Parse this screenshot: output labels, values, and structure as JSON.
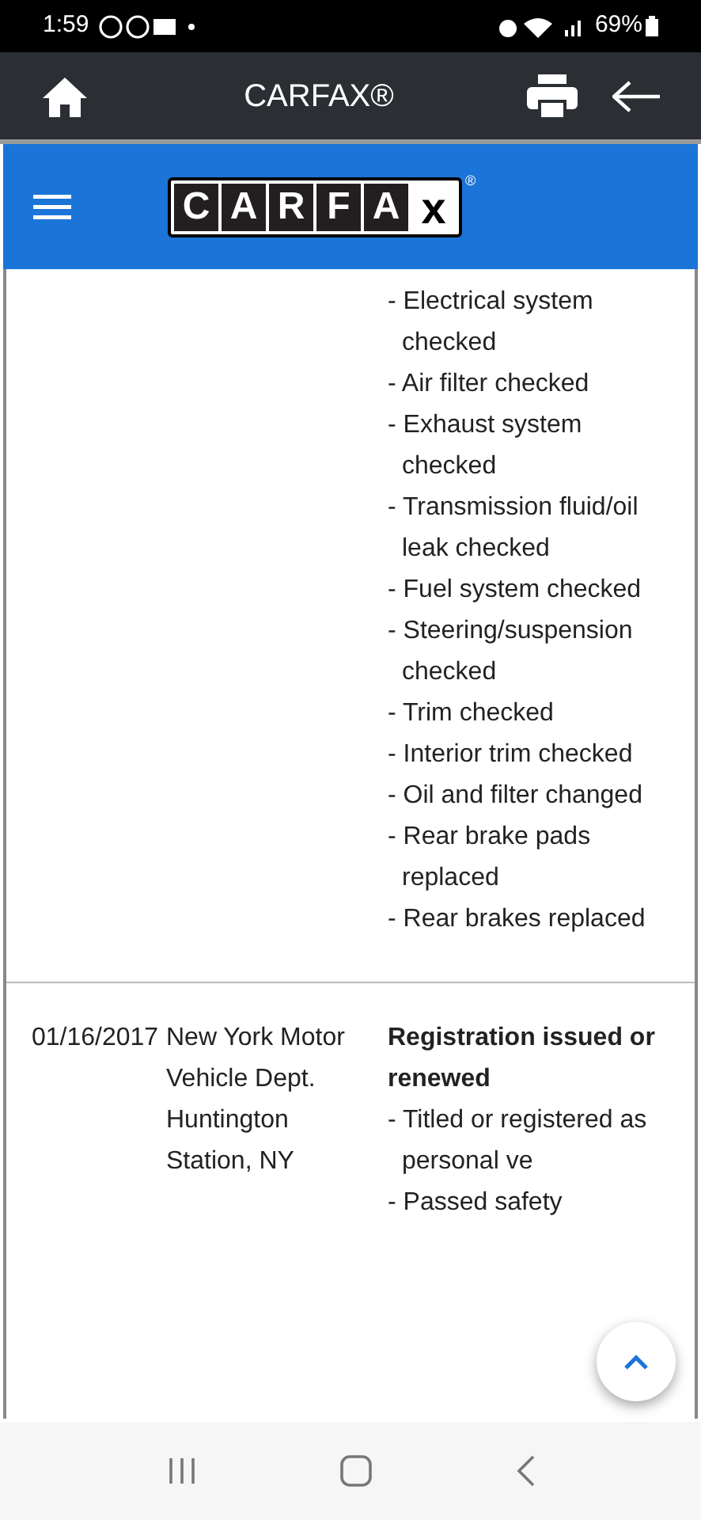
{
  "status_bar": {
    "time": "1:59",
    "battery": "69%"
  },
  "app_bar": {
    "title": "CARFAX®"
  },
  "site_header": {
    "logo_letters": [
      "C",
      "A",
      "R",
      "F",
      "A",
      "x"
    ],
    "logo_mark": "®"
  },
  "records": [
    {
      "items": [
        "- Electrical system checked",
        "- Air filter checked",
        "- Exhaust system checked",
        "- Transmission fluid/oil leak checked",
        "- Fuel system checked",
        "- Steering/suspension checked",
        "- Trim checked",
        "- Interior trim checked",
        "- Oil and filter changed",
        "- Rear brake pads replaced",
        "- Rear brakes replaced"
      ]
    },
    {
      "date": "01/16/2017",
      "source": "New York Motor Vehicle Dept. Huntington Station, NY",
      "title": "Registration issued or renewed",
      "items": [
        "- Titled or registered as personal ve",
        "- Passed safety"
      ]
    }
  ]
}
